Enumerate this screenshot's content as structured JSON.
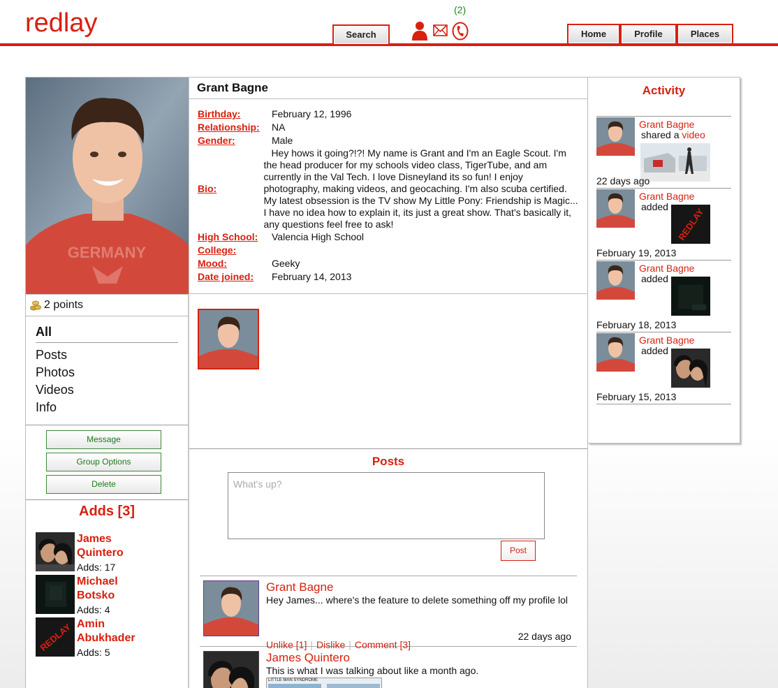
{
  "app": {
    "logo": "redlay"
  },
  "header": {
    "search_label": "Search",
    "notifications_count": "(2)",
    "nav": {
      "home": "Home",
      "profile": "Profile",
      "places": "Places"
    }
  },
  "profile": {
    "name": "Grant Bagne",
    "points": "2 points",
    "fields": {
      "birthday_label": "Birthday:",
      "birthday": "February 12, 1996",
      "relationship_label": "Relationship:",
      "relationship": "NA",
      "gender_label": "Gender:",
      "gender": "Male",
      "bio_label": "Bio:",
      "bio": "Hey hows it going?!?! My name is Grant and I'm an Eagle Scout. I'm the head producer for my schools video class, TigerTube, and am currently in the Val Tech. I love Disneyland its so fun! I enjoy photography, making videos, and geocaching. I'm also scuba certified. My latest obsession is the TV show My Little Pony: Friendship is Magic... I have no idea how to explain it, its just a great show. That's basically it, any questions feel free to ask!",
      "high_school_label": "High School:",
      "high_school": "Valencia High School",
      "college_label": "College:",
      "college": "",
      "mood_label": "Mood:",
      "mood": "Geeky",
      "date_joined_label": "Date joined:",
      "date_joined": "February 14, 2013"
    }
  },
  "filters": {
    "all": "All",
    "posts": "Posts",
    "photos": "Photos",
    "videos": "Videos",
    "info": "Info"
  },
  "actions": {
    "message": "Message",
    "group_options": "Group Options",
    "delete": "Delete"
  },
  "adds": {
    "title": "Adds [3]",
    "items": [
      {
        "first": "James",
        "last": "Quintero",
        "count": "Adds: 17"
      },
      {
        "first": "Michael",
        "last": "Botsko",
        "count": "Adds: 4"
      },
      {
        "first": "Amin",
        "last": "Abukhader",
        "count": "Adds: 5"
      }
    ]
  },
  "posts": {
    "title": "Posts",
    "placeholder": "What's up?",
    "post_button": "Post",
    "feed": [
      {
        "author": "Grant Bagne",
        "text": "Hey James... where's the feature to delete something off my profile lol",
        "unlike": "Unlike [1]",
        "dislike": "Dislike",
        "comment": "Comment [3]",
        "time": "22 days ago"
      },
      {
        "author": "James Quintero",
        "text": "This is what I was talking about like a month ago."
      }
    ]
  },
  "activity": {
    "title": "Activity",
    "items": [
      {
        "name": "Grant Bagne",
        "verb": "shared a",
        "link": "video",
        "date": "22 days ago"
      },
      {
        "name": "Grant Bagne",
        "verb": "added",
        "link": "",
        "date": "February 19, 2013"
      },
      {
        "name": "Grant Bagne",
        "verb": "added",
        "link": "",
        "date": "February 18, 2013"
      },
      {
        "name": "Grant Bagne",
        "verb": "added",
        "link": "",
        "date": "February 15, 2013"
      }
    ]
  },
  "images": {
    "redlay_badge": "REDLAY",
    "comic_caption": "LITTLE MAN SYNDROME"
  },
  "colors": {
    "accent": "#d8200f",
    "action_green": "#1a7a1a",
    "notification_green": "#1a8a1a"
  }
}
